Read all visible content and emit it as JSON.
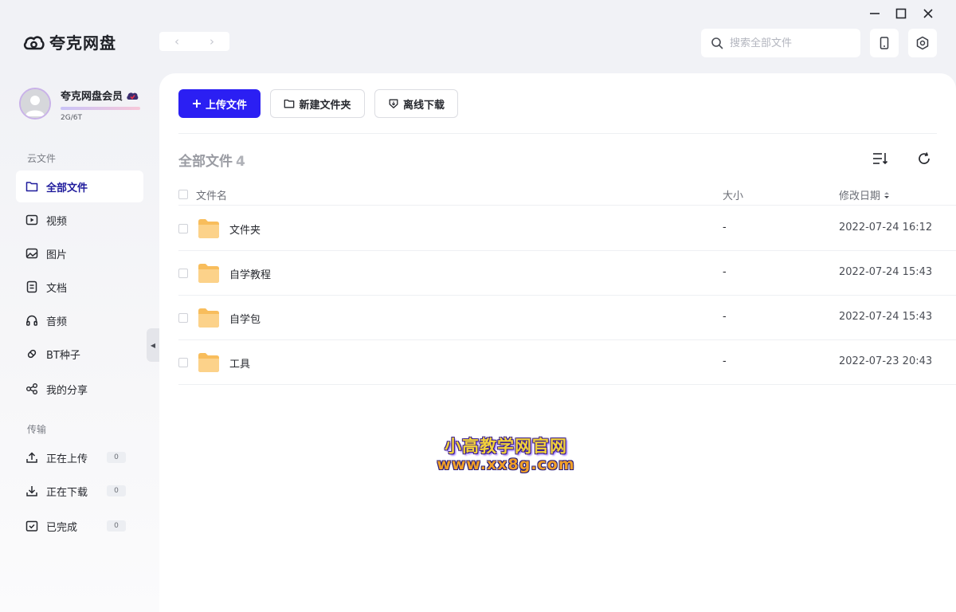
{
  "app": {
    "name": "夸克网盘"
  },
  "search": {
    "placeholder": "搜索全部文件"
  },
  "user": {
    "name": "夸克网盘会员",
    "quota": "2G/6T"
  },
  "sidebar": {
    "cloud_section": "云文件",
    "items": [
      {
        "label": "全部文件",
        "icon": "folder-icon",
        "active": true
      },
      {
        "label": "视频",
        "icon": "video-icon"
      },
      {
        "label": "图片",
        "icon": "image-icon"
      },
      {
        "label": "文档",
        "icon": "document-icon"
      },
      {
        "label": "音频",
        "icon": "headphones-icon"
      },
      {
        "label": "BT种子",
        "icon": "magnet-icon"
      },
      {
        "label": "我的分享",
        "icon": "share-icon"
      }
    ],
    "transfer_section": "传输",
    "transfers": [
      {
        "label": "正在上传",
        "count": "0",
        "icon": "upload-icon"
      },
      {
        "label": "正在下载",
        "count": "0",
        "icon": "download-icon"
      },
      {
        "label": "已完成",
        "count": "0",
        "icon": "completed-icon"
      }
    ]
  },
  "toolbar": {
    "upload_label": "上传文件",
    "new_folder_label": "新建文件夹",
    "offline_download_label": "离线下载"
  },
  "breadcrumb": {
    "title": "全部文件",
    "count": "4"
  },
  "table": {
    "columns": {
      "name": "文件名",
      "size": "大小",
      "date": "修改日期"
    },
    "rows": [
      {
        "name": "文件夹",
        "size": "-",
        "date": "2022-07-24 16:12"
      },
      {
        "name": "自学教程",
        "size": "-",
        "date": "2022-07-24 15:43"
      },
      {
        "name": "自学包",
        "size": "-",
        "date": "2022-07-24 15:43"
      },
      {
        "name": "工具",
        "size": "-",
        "date": "2022-07-23 20:43"
      }
    ]
  },
  "watermark": {
    "line1": "小高教学网官网",
    "line2": "www.xx8g.com"
  },
  "colors": {
    "accent": "#2b1ff3",
    "active_nav": "#1f1b9c",
    "folder": "#fcc66b"
  }
}
